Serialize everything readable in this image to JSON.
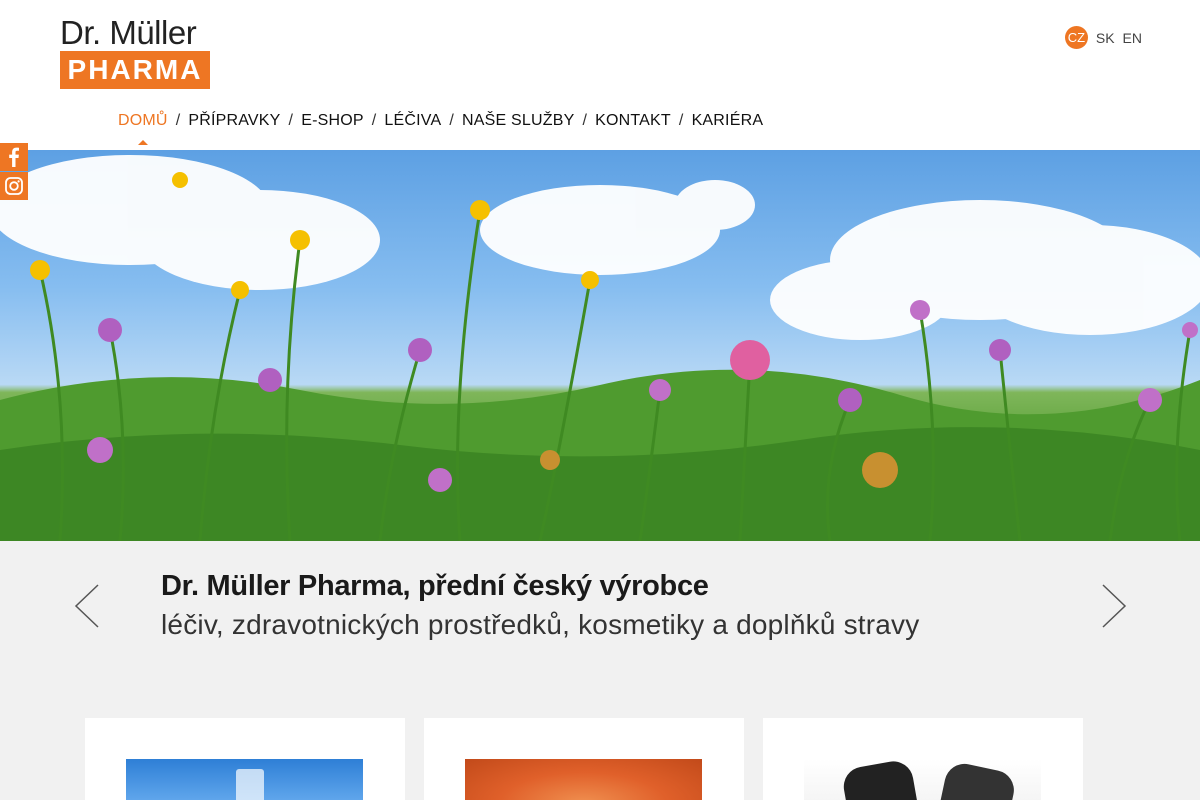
{
  "logo": {
    "line1": "Dr. Müller",
    "line2": "PHARMA"
  },
  "languages": [
    {
      "code": "CZ",
      "active": true
    },
    {
      "code": "SK",
      "active": false
    },
    {
      "code": "EN",
      "active": false
    }
  ],
  "nav": [
    {
      "label": "DOMŮ",
      "active": true
    },
    {
      "label": "PŘÍPRAVKY"
    },
    {
      "label": "E-SHOP"
    },
    {
      "label": "LÉČIVA"
    },
    {
      "label": "NAŠE SLUŽBY"
    },
    {
      "label": "KONTAKT"
    },
    {
      "label": "KARIÉRA"
    }
  ],
  "nav_separator": "/",
  "social": [
    {
      "icon": "facebook-icon"
    },
    {
      "icon": "instagram-icon"
    }
  ],
  "slider": {
    "headline": "Dr. Müller Pharma, přední český výrobce",
    "subline": "léčiv, zdravotnických prostředků, kosmetiky a doplňků stravy"
  },
  "cards": [
    {
      "image": "blue-product-image"
    },
    {
      "image": "orange-product-image"
    },
    {
      "image": "hands-image"
    }
  ],
  "colors": {
    "accent": "#ee7623",
    "band": "#f1f1f1",
    "text": "#1a1a1a"
  }
}
